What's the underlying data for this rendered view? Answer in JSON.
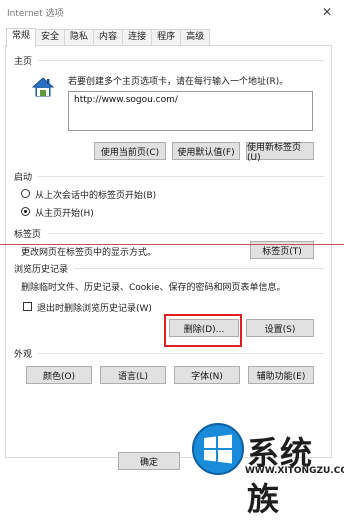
{
  "window": {
    "title": "Internet 选项",
    "close_glyph": "✕"
  },
  "tabs": [
    {
      "label": "常规",
      "active": true
    },
    {
      "label": "安全"
    },
    {
      "label": "隐私"
    },
    {
      "label": "内容"
    },
    {
      "label": "连接"
    },
    {
      "label": "程序"
    },
    {
      "label": "高级"
    }
  ],
  "homepage": {
    "section_title": "主页",
    "icon": "house-icon",
    "description": "若要创建多个主页选项卡，请在每行输入一个地址(R)。",
    "url": "http://www.sogou.com/",
    "use_current_label": "使用当前页(C)",
    "use_default_label": "使用默认值(F)",
    "use_new_tab_label": "使用新标签页(U)"
  },
  "startup": {
    "section_title": "启动",
    "option_last_session": "从上次会话中的标签页开始(B)",
    "option_home_page": "从主页开始(H)",
    "selected": "home_page"
  },
  "tabs_section": {
    "section_title": "标签页",
    "description": "更改网页在标签页中的显示方式。",
    "button_label": "标签页(T)"
  },
  "browsing_history": {
    "section_title": "浏览历史记录",
    "description": "删除临时文件、历史记录、Cookie、保存的密码和网页表单信息。",
    "delete_on_exit_label": "退出时删除浏览历史记录(W)",
    "delete_on_exit_checked": false,
    "delete_label": "删除(D)...",
    "settings_label": "设置(S)"
  },
  "appearance": {
    "section_title": "外观",
    "colors_label": "颜色(O)",
    "languages_label": "语言(L)",
    "fonts_label": "字体(N)",
    "accessibility_label": "辅助功能(E)"
  },
  "footer": {
    "ok_label": "确定"
  },
  "watermark": {
    "title": "系统族",
    "url": "WWW.XITONGZU.COM"
  },
  "colors": {
    "highlight_red": "#e02020",
    "guide_line_red": "#c85050",
    "button_face": "#e1e1e1"
  }
}
